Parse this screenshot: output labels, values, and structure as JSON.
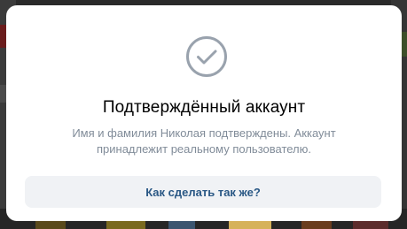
{
  "modal": {
    "icon": "check-circle-icon",
    "title": "Подтверждённый аккаунт",
    "description": "Имя и фамилия Николая подтверждены. Аккаунт принадлежит реальному пользователю.",
    "action_label": "Как сделать так же?"
  },
  "colors": {
    "accent_text": "#2a5885",
    "icon_gray": "#99a2ad",
    "secondary_text": "#818c99",
    "button_bg": "#f0f2f5"
  }
}
